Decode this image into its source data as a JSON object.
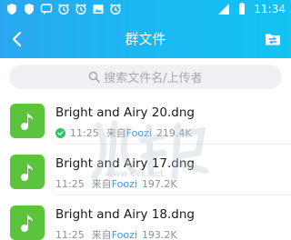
{
  "status_bar": {
    "left_icons": [
      "shield-icon",
      "shield-icon",
      "chat-bubble-icon",
      "alarm-icon",
      "alarm-icon",
      "image-icon",
      "alarm-icon"
    ],
    "time": "11:34"
  },
  "header": {
    "title": "群文件",
    "back_icon": "chevron-left-icon",
    "action_icon": "folder-swap-icon"
  },
  "search": {
    "placeholder": "搜索文件名/上传者"
  },
  "files": [
    {
      "name": "Bright and Airy 20.dng",
      "downloaded": true,
      "time": "11:25",
      "from_label": "来自",
      "uploader": "Foozi",
      "size": "219.4K"
    },
    {
      "name": "Bright and Airy 17.dng",
      "downloaded": false,
      "time": "11:25",
      "from_label": "来自",
      "uploader": "Foozi",
      "size": "197.2K"
    },
    {
      "name": "Bright and Airy 18.dng",
      "downloaded": false,
      "time": "11:25",
      "from_label": "来自",
      "uploader": "Foozi",
      "size": "193.2K"
    }
  ],
  "watermark": {
    "url": "www.kkx.net"
  },
  "colors": {
    "header_gradient_start": "#2aa7f0",
    "header_gradient_end": "#14c3f0",
    "file_icon_green": "#5cc43c",
    "downloaded_check": "#2cc36b",
    "uploader_link": "#3d97d6"
  }
}
